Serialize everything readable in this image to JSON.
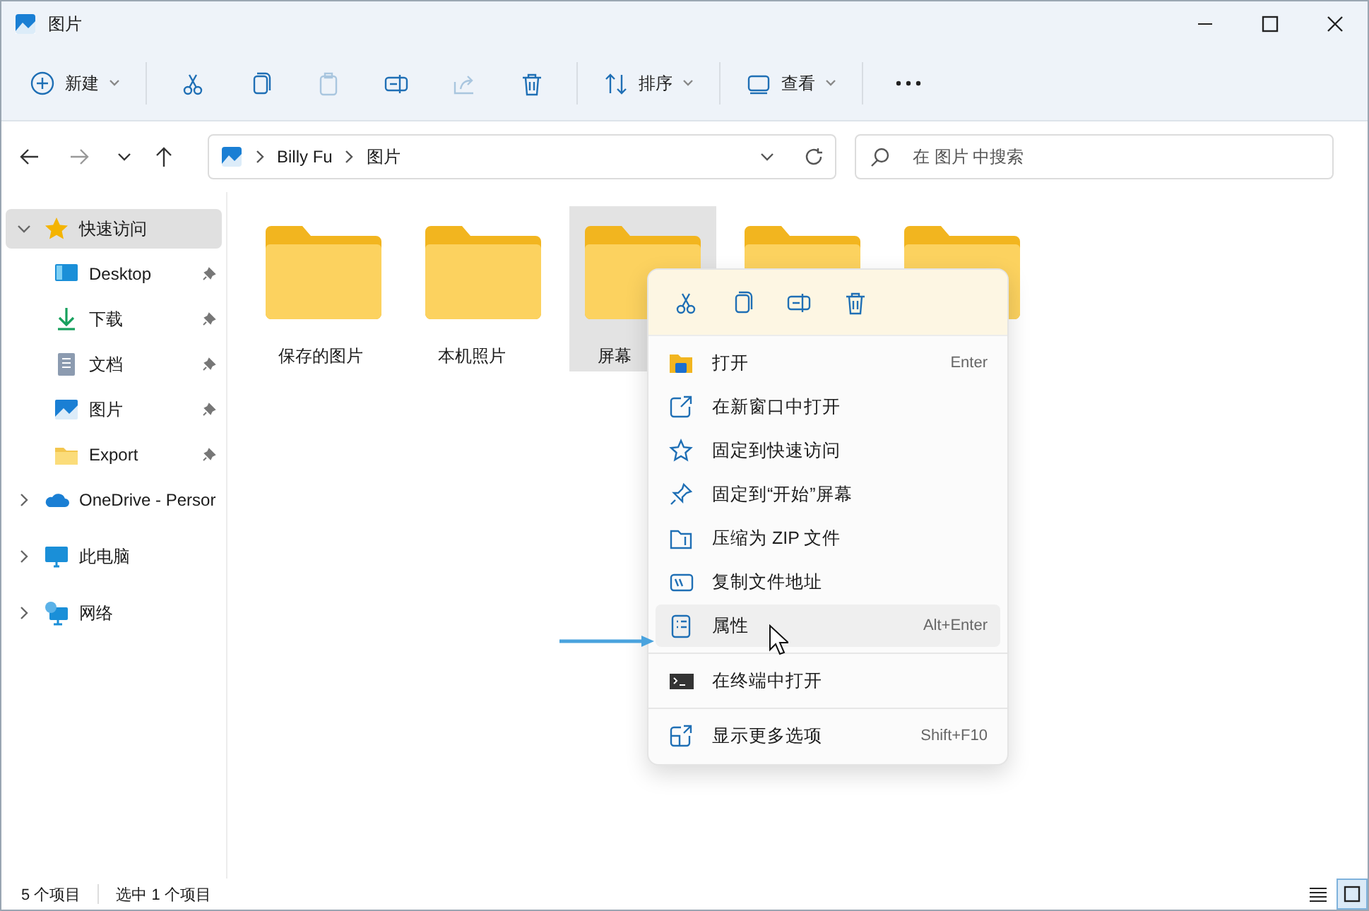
{
  "window": {
    "title": "图片"
  },
  "toolbar": {
    "buttons": [
      {
        "kind": "labeled",
        "label": "新建",
        "disabled": false
      },
      {
        "kind": "icon",
        "disabled": false
      },
      {
        "kind": "icon",
        "disabled": false
      },
      {
        "kind": "icon",
        "disabled": true
      },
      {
        "kind": "icon",
        "disabled": false
      },
      {
        "kind": "icon",
        "disabled": true
      },
      {
        "kind": "icon",
        "disabled": false
      },
      {
        "kind": "labeled",
        "label": "排序",
        "disabled": false
      },
      {
        "kind": "labeled",
        "label": "查看",
        "disabled": false
      },
      {
        "kind": "more",
        "disabled": false
      }
    ]
  },
  "address": {
    "path": [
      "Billy Fu",
      "图片"
    ]
  },
  "search": {
    "placeholder": "在 图片 中搜索"
  },
  "sidebar": {
    "items": [
      {
        "label": "快速访问",
        "expanded": true,
        "selected": true,
        "children": [
          {
            "label": "Desktop",
            "pinned": true,
            "selected": false
          },
          {
            "label": "下载",
            "pinned": true,
            "selected": false
          },
          {
            "label": "文档",
            "pinned": true,
            "selected": false
          },
          {
            "label": "图片",
            "pinned": true,
            "selected": false
          },
          {
            "label": "Export",
            "pinned": true,
            "selected": false
          }
        ]
      },
      {
        "label": "OneDrive - Persor",
        "expanded": false,
        "selected": false
      },
      {
        "label": "此电脑",
        "expanded": false,
        "selected": false
      },
      {
        "label": "网络",
        "expanded": false,
        "selected": false
      }
    ]
  },
  "folders": [
    {
      "label": "保存的图片",
      "selected": false
    },
    {
      "label": "本机照片",
      "selected": false
    },
    {
      "label": "屏幕",
      "selected": true
    },
    {
      "selected": false
    },
    {
      "selected": false
    }
  ],
  "context_menu": {
    "items": [
      {
        "kind": "item",
        "label": "打开",
        "shortcut": "Enter",
        "highlighted": false
      },
      {
        "kind": "item",
        "label": "在新窗口中打开",
        "highlighted": false
      },
      {
        "kind": "item",
        "label": "固定到快速访问",
        "highlighted": false
      },
      {
        "kind": "item",
        "label": "固定到“开始”屏幕",
        "highlighted": false
      },
      {
        "kind": "item",
        "label": "压缩为 ZIP 文件",
        "highlighted": false
      },
      {
        "kind": "item",
        "label": "复制文件地址",
        "highlighted": false
      },
      {
        "kind": "item",
        "label": "属性",
        "shortcut": "Alt+Enter",
        "highlighted": true
      },
      {
        "kind": "separator"
      },
      {
        "kind": "item",
        "label": "在终端中打开",
        "highlighted": false
      },
      {
        "kind": "separator"
      },
      {
        "kind": "item",
        "label": "显示更多选项",
        "shortcut": "Shift+F10",
        "highlighted": false
      }
    ]
  },
  "status_bar": {
    "item_count": "5 个项目",
    "selection": "选中 1 个项目",
    "views": [
      {
        "selected": false
      },
      {
        "selected": true
      }
    ]
  }
}
